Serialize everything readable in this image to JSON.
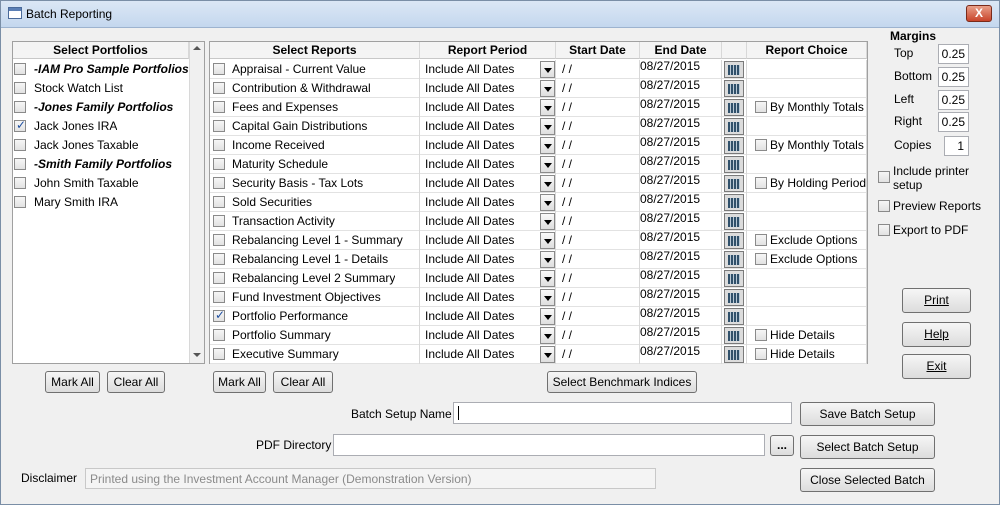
{
  "window": {
    "title": "Batch Reporting",
    "close_label": "X"
  },
  "portfolios": {
    "header": "Select Portfolios",
    "items": [
      {
        "label": "-IAM Pro Sample Portfolios",
        "bold": true,
        "checked": false
      },
      {
        "label": "Stock Watch List",
        "bold": false,
        "checked": false
      },
      {
        "label": "-Jones Family Portfolios",
        "bold": true,
        "checked": false
      },
      {
        "label": "Jack Jones IRA",
        "bold": false,
        "checked": true
      },
      {
        "label": "Jack Jones Taxable",
        "bold": false,
        "checked": false
      },
      {
        "label": "-Smith Family Portfolios",
        "bold": true,
        "checked": false
      },
      {
        "label": "John Smith Taxable",
        "bold": false,
        "checked": false
      },
      {
        "label": "Mary Smith IRA",
        "bold": false,
        "checked": false
      }
    ],
    "mark_all": "Mark All",
    "clear_all": "Clear All"
  },
  "reports": {
    "headers": {
      "select": "Select Reports",
      "period": "Report Period",
      "start": "Start Date",
      "end": "End Date",
      "choice": "Report Choice"
    },
    "rows": [
      {
        "name": "Appraisal - Current Value",
        "checked": false,
        "period": "Include All Dates",
        "start": "/ /",
        "end": "08/27/2015",
        "choice": ""
      },
      {
        "name": "Contribution & Withdrawal",
        "checked": false,
        "period": "Include All Dates",
        "start": "/ /",
        "end": "08/27/2015",
        "choice": ""
      },
      {
        "name": "Fees and Expenses",
        "checked": false,
        "period": "Include All Dates",
        "start": "/ /",
        "end": "08/27/2015",
        "choice": "By Monthly Totals"
      },
      {
        "name": "Capital Gain Distributions",
        "checked": false,
        "period": "Include All Dates",
        "start": "/ /",
        "end": "08/27/2015",
        "choice": ""
      },
      {
        "name": "Income Received",
        "checked": false,
        "period": "Include All Dates",
        "start": "/ /",
        "end": "08/27/2015",
        "choice": "By Monthly Totals"
      },
      {
        "name": "Maturity Schedule",
        "checked": false,
        "period": "Include All Dates",
        "start": "/ /",
        "end": "08/27/2015",
        "choice": ""
      },
      {
        "name": "Security Basis - Tax Lots",
        "checked": false,
        "period": "Include All Dates",
        "start": "/ /",
        "end": "08/27/2015",
        "choice": "By Holding Period"
      },
      {
        "name": "Sold Securities",
        "checked": false,
        "period": "Include All Dates",
        "start": "/ /",
        "end": "08/27/2015",
        "choice": ""
      },
      {
        "name": "Transaction Activity",
        "checked": false,
        "period": "Include All Dates",
        "start": "/ /",
        "end": "08/27/2015",
        "choice": ""
      },
      {
        "name": "Rebalancing Level 1 - Summary",
        "checked": false,
        "period": "Include All Dates",
        "start": "/ /",
        "end": "08/27/2015",
        "choice": "Exclude Options"
      },
      {
        "name": "Rebalancing Level 1 - Details",
        "checked": false,
        "period": "Include All Dates",
        "start": "/ /",
        "end": "08/27/2015",
        "choice": "Exclude Options"
      },
      {
        "name": "Rebalancing Level 2 Summary",
        "checked": false,
        "period": "Include All Dates",
        "start": "/ /",
        "end": "08/27/2015",
        "choice": ""
      },
      {
        "name": "Fund Investment Objectives",
        "checked": false,
        "period": "Include All Dates",
        "start": "/ /",
        "end": "08/27/2015",
        "choice": ""
      },
      {
        "name": "Portfolio Performance",
        "checked": true,
        "period": "Include All Dates",
        "start": "/ /",
        "end": "08/27/2015",
        "choice": ""
      },
      {
        "name": "Portfolio Summary",
        "checked": false,
        "period": "Include All Dates",
        "start": "/ /",
        "end": "08/27/2015",
        "choice": "Hide Details"
      },
      {
        "name": "Executive Summary",
        "checked": false,
        "period": "Include All Dates",
        "start": "/ /",
        "end": "08/27/2015",
        "choice": "Hide Details"
      }
    ],
    "mark_all": "Mark All",
    "clear_all": "Clear All",
    "benchmark": "Select Benchmark Indices"
  },
  "margins": {
    "title": "Margins",
    "top_label": "Top",
    "top": "0.25",
    "bottom_label": "Bottom",
    "bottom": "0.25",
    "left_label": "Left",
    "left": "0.25",
    "right_label": "Right",
    "right": "0.25",
    "copies_label": "Copies",
    "copies": "1"
  },
  "options": {
    "include_printer_setup": "Include printer setup",
    "preview_reports": "Preview Reports",
    "export_pdf": "Export to PDF"
  },
  "actions": {
    "print": "Print",
    "help": "Help",
    "exit": "Exit"
  },
  "batch": {
    "setup_name_label": "Batch Setup Name",
    "setup_name_value": "",
    "save": "Save Batch Setup",
    "pdf_label": "PDF Directory",
    "pdf_value": "",
    "browse": "...",
    "select": "Select Batch Setup",
    "disclaimer_label": "Disclaimer",
    "disclaimer_value": "Printed using the Investment Account Manager (Demonstration Version)",
    "close": "Close Selected Batch"
  }
}
